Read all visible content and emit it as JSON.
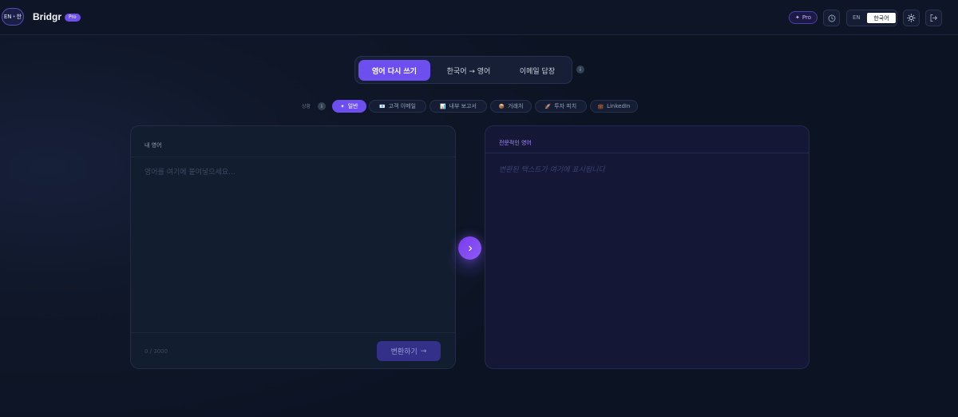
{
  "header": {
    "logo": {
      "left": "EN",
      "sep": "•",
      "right": "한"
    },
    "brand": "Bridgr",
    "brand_badge": "Pro",
    "pro_button": {
      "icon": "✦",
      "label": "Pro"
    },
    "lang_toggle": {
      "en": "EN",
      "ko": "한국어",
      "selected": "한국어"
    }
  },
  "tabs": [
    {
      "label": "영어 다시 쓰기",
      "active": true
    },
    {
      "label": "한국어 → 영어",
      "active": false
    },
    {
      "label": "이메일 답장",
      "active": false
    }
  ],
  "tabs_info": "i",
  "situations": {
    "label": "상황",
    "info": "i",
    "chips": [
      {
        "icon": "✦",
        "label": "일반",
        "active": true
      },
      {
        "icon": "📧",
        "label": "고객 이메일",
        "active": false
      },
      {
        "icon": "📊",
        "label": "내부 보고서",
        "active": false
      },
      {
        "icon": "📦",
        "label": "거래처",
        "active": false
      },
      {
        "icon": "🚀",
        "label": "투자 피치",
        "active": false
      },
      {
        "icon": "💼",
        "label": "LinkedIn",
        "active": false
      }
    ]
  },
  "input_panel": {
    "title": "내 영어",
    "placeholder": "영어를 여기에 붙여넣으세요...",
    "value": "",
    "char_count": "0 / 3000",
    "convert_label": "변환하기",
    "convert_icon": "→"
  },
  "output_panel": {
    "title": "전문적인 영어",
    "placeholder": "변환된 텍스트가 여기에 표시됩니다"
  },
  "colors": {
    "accent": "#6d4ff0",
    "background": "#0f1729",
    "panel": "#131d30",
    "output_panel": "#141736"
  }
}
